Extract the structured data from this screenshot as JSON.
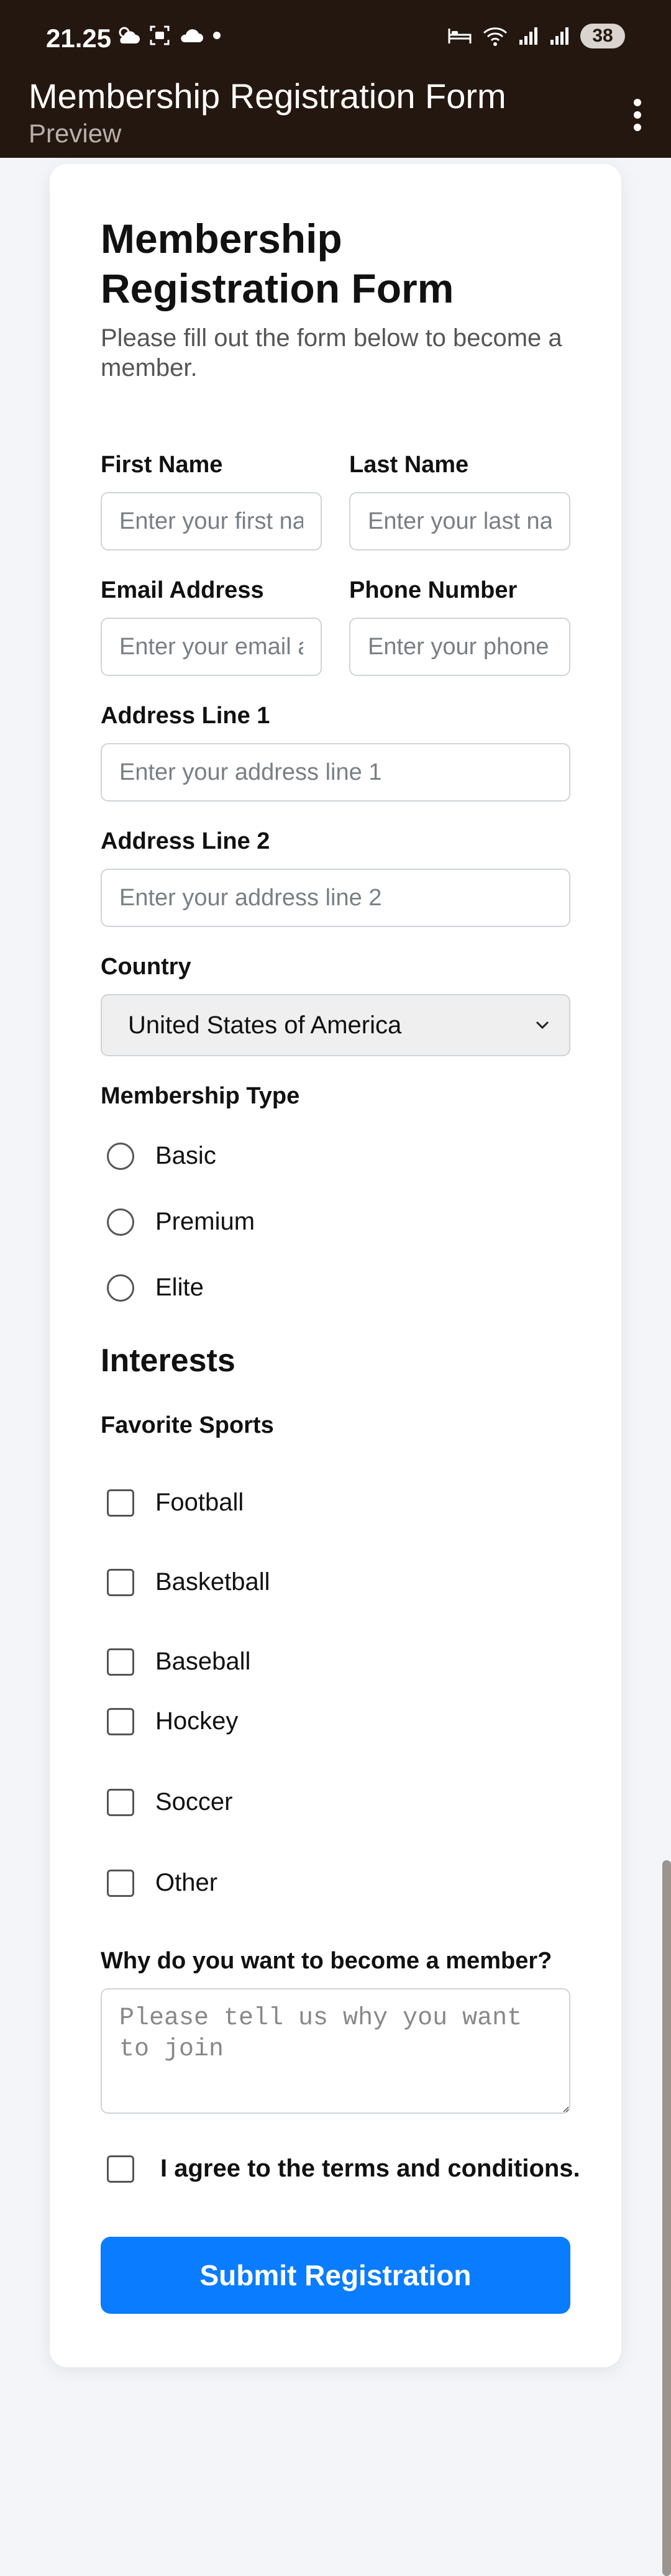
{
  "status_bar": {
    "time": "21.25",
    "battery": "38"
  },
  "app_bar": {
    "title": "Membership Registration Form",
    "subtitle": "Preview"
  },
  "form": {
    "title": "Membership Registration Form",
    "description": "Please fill out the form below to become a member.",
    "first_name": {
      "label": "First Name",
      "placeholder": "Enter your first name"
    },
    "last_name": {
      "label": "Last Name",
      "placeholder": "Enter your last name"
    },
    "email": {
      "label": "Email Address",
      "placeholder": "Enter your email address"
    },
    "phone": {
      "label": "Phone Number",
      "placeholder": "Enter your phone number"
    },
    "address1": {
      "label": "Address Line 1",
      "placeholder": "Enter your address line 1"
    },
    "address2": {
      "label": "Address Line 2",
      "placeholder": "Enter your address line 2"
    },
    "country": {
      "label": "Country",
      "selected": "United States of America"
    },
    "membership": {
      "label": "Membership Type",
      "options": [
        "Basic",
        "Premium",
        "Elite"
      ]
    },
    "interests_heading": "Interests",
    "sports": {
      "label": "Favorite Sports",
      "options": [
        "Football",
        "Basketball",
        "Baseball",
        "Hockey",
        "Soccer",
        "Other"
      ]
    },
    "why": {
      "label": "Why do you want to become a member?",
      "placeholder": "Please tell us why you want to join"
    },
    "terms_label": "I agree to the terms and conditions.",
    "submit_label": "Submit Registration"
  },
  "colors": {
    "appbar_bg": "#24170f",
    "accent": "#0a7cff"
  }
}
